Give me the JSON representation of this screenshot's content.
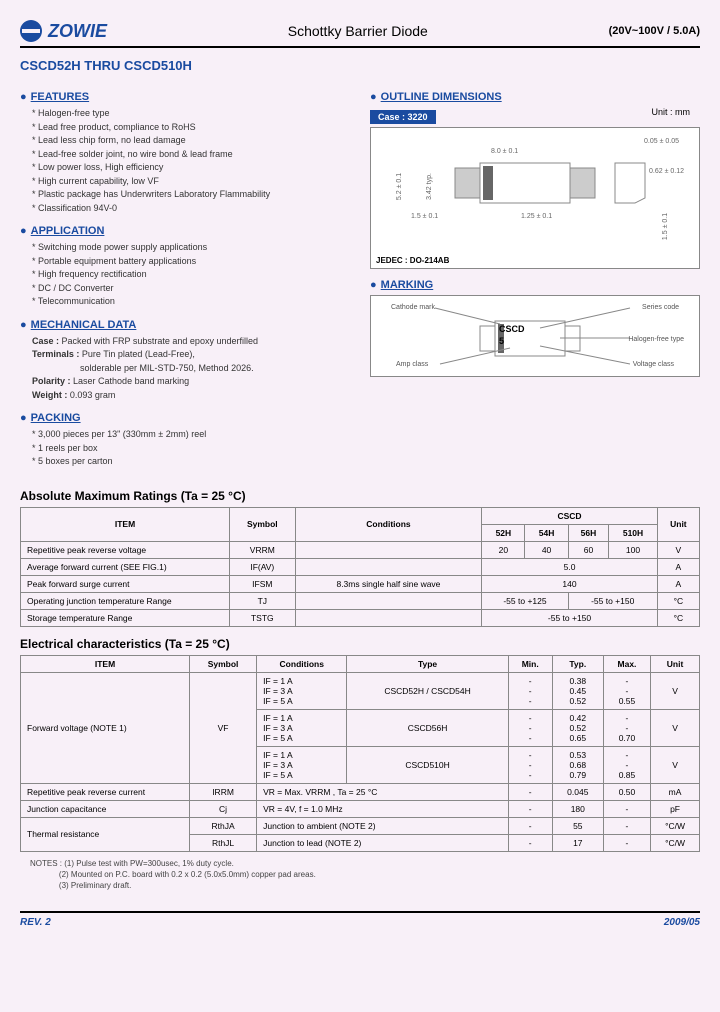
{
  "header": {
    "brand": "ZOWIE",
    "title": "Schottky Barrier Diode",
    "spec": "(20V~100V / 5.0A)"
  },
  "part_title": "CSCD52H THRU CSCD510H",
  "sections": {
    "features_head": "FEATURES",
    "features": [
      "Halogen-free type",
      "Lead free product, compliance to RoHS",
      "Lead less chip form, no lead damage",
      "Lead-free solder joint, no wire bond & lead frame",
      "Low power loss, High efficiency",
      "High current capability, low VF",
      "Plastic package has Underwriters Laboratory Flammability",
      "Classification 94V-0"
    ],
    "application_head": "APPLICATION",
    "application": [
      "Switching mode power supply applications",
      "Portable equipment battery applications",
      "High frequency rectification",
      "DC / DC Converter",
      "Telecommunication"
    ],
    "mech_head": "MECHANICAL DATA",
    "mech": {
      "case_label": "Case :",
      "case": "Packed with FRP substrate and epoxy underfilled",
      "term_label": "Terminals :",
      "term1": "Pure Tin plated (Lead-Free),",
      "term2": "solderable per MIL-STD-750, Method 2026.",
      "polarity_label": "Polarity :",
      "polarity": "Laser Cathode band marking",
      "weight_label": "Weight :",
      "weight": "0.093 gram"
    },
    "packing_head": "PACKING",
    "packing": [
      "3,000 pieces per 13\" (330mm ± 2mm) reel",
      "1 reels per box",
      "5 boxes per carton"
    ],
    "outline_head": "OUTLINE DIMENSIONS",
    "case_tag": "Case : 3220",
    "unit_mm": "Unit : mm",
    "jedec": "JEDEC : DO-214AB",
    "marking_head": "MARKING",
    "marking_labels": {
      "cathode": "Cathode mark",
      "series": "Series code",
      "cscd": "CSCD",
      "five": "5",
      "amp": "Amp class",
      "halogen": "Halogen-free type",
      "voltage": "Voltage class"
    }
  },
  "abs_title": "Absolute Maximum Ratings (Ta = 25 °C)",
  "abs_table": {
    "head_item": "ITEM",
    "head_symbol": "Symbol",
    "head_cond": "Conditions",
    "head_cscd": "CSCD",
    "head_unit": "Unit",
    "cols": [
      "52H",
      "54H",
      "56H",
      "510H"
    ],
    "rows": [
      {
        "item": "Repetitive peak reverse voltage",
        "sym": "VRRM",
        "cond": "",
        "v": [
          "20",
          "40",
          "60",
          "100"
        ],
        "unit": "V"
      },
      {
        "item": "Average forward current (SEE FIG.1)",
        "sym": "IF(AV)",
        "cond": "",
        "span": "5.0",
        "unit": "A"
      },
      {
        "item": "Peak forward surge current",
        "sym": "IFSM",
        "cond": "8.3ms single half sine wave",
        "span": "140",
        "unit": "A"
      },
      {
        "item": "Operating junction temperature Range",
        "sym": "TJ",
        "cond": "",
        "left": "-55 to +125",
        "right": "-55 to +150",
        "unit": "°C"
      },
      {
        "item": "Storage temperature Range",
        "sym": "TSTG",
        "cond": "",
        "span": "-55 to +150",
        "unit": "°C"
      }
    ]
  },
  "elec_title": "Electrical characteristics (Ta = 25 °C)",
  "elec_table": {
    "head": [
      "ITEM",
      "Symbol",
      "Conditions",
      "Type",
      "Min.",
      "Typ.",
      "Max.",
      "Unit"
    ],
    "fwd_label": "Forward voltage (NOTE 1)",
    "fwd_sym": "VF",
    "cond_lines": [
      "IF = 1 A",
      "IF = 3 A",
      "IF = 5 A"
    ],
    "groups": [
      {
        "type": "CSCD52H / CSCD54H",
        "typ": [
          "0.38",
          "0.45",
          "0.52"
        ],
        "max": [
          "-",
          "-",
          "0.55"
        ],
        "unit": "V"
      },
      {
        "type": "CSCD56H",
        "typ": [
          "0.42",
          "0.52",
          "0.65"
        ],
        "max": [
          "-",
          "-",
          "0.70"
        ],
        "unit": "V"
      },
      {
        "type": "CSCD510H",
        "typ": [
          "0.53",
          "0.68",
          "0.79"
        ],
        "max": [
          "-",
          "-",
          "0.85"
        ],
        "unit": "V"
      }
    ],
    "rows": [
      {
        "item": "Repetitive peak reverse current",
        "sym": "IRRM",
        "cond": "VR = Max. VRRM , Ta = 25 °C",
        "min": "-",
        "typ": "0.045",
        "max": "0.50",
        "unit": "mA"
      },
      {
        "item": "Junction capacitance",
        "sym": "Cj",
        "cond": "VR = 4V, f = 1.0 MHz",
        "min": "-",
        "typ": "180",
        "max": "-",
        "unit": "pF"
      }
    ],
    "thermal_label": "Thermal resistance",
    "thermal": [
      {
        "sym": "RthJA",
        "cond": "Junction to ambient (NOTE 2)",
        "min": "-",
        "typ": "55",
        "max": "-",
        "unit": "°C/W"
      },
      {
        "sym": "RthJL",
        "cond": "Junction to lead (NOTE 2)",
        "min": "-",
        "typ": "17",
        "max": "-",
        "unit": "°C/W"
      }
    ]
  },
  "notes": {
    "label": "NOTES :",
    "n1": "(1) Pulse test with PW=300usec, 1% duty cycle.",
    "n2": "(2) Mounted on P.C. board with 0.2 x 0.2 (5.0x5.0mm) copper pad areas.",
    "n3": "(3) Preliminary draft."
  },
  "footer": {
    "rev": "REV. 2",
    "date": "2009/05"
  },
  "chart_data": {
    "type": "table",
    "title": "Absolute Maximum Ratings (Ta = 25 °C)",
    "categories": [
      "CSCD52H",
      "CSCD54H",
      "CSCD56H",
      "CSCD510H"
    ],
    "series": [
      {
        "name": "VRRM (V)",
        "values": [
          20,
          40,
          60,
          100
        ]
      },
      {
        "name": "IF(AV) (A)",
        "values": [
          5.0,
          5.0,
          5.0,
          5.0
        ]
      },
      {
        "name": "IFSM (A)",
        "values": [
          140,
          140,
          140,
          140
        ]
      }
    ]
  }
}
